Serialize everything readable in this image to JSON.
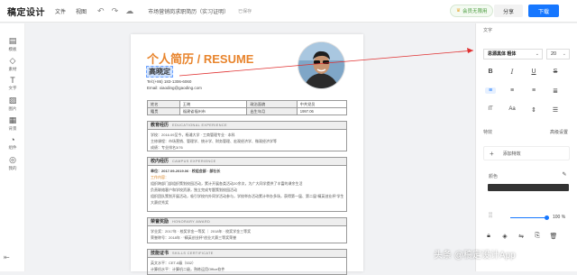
{
  "topbar": {
    "logo": "稿定设计",
    "file_menu": "文件",
    "view_menu": "视图",
    "doc_name": "市场营销岗求职简历（实习证明）",
    "save_state": "已保存",
    "vip": "会员无限用",
    "share": "分享",
    "download": "下载"
  },
  "left_tools": [
    {
      "icon": "layout-icon",
      "glyph": "▤",
      "label": "模板"
    },
    {
      "icon": "shapes-icon",
      "glyph": "◇",
      "label": "素材"
    },
    {
      "icon": "text-icon",
      "glyph": "T",
      "label": "文字"
    },
    {
      "icon": "image-icon",
      "glyph": "▨",
      "label": "图片"
    },
    {
      "icon": "background-icon",
      "glyph": "▦",
      "label": "背景"
    },
    {
      "icon": "chart-icon",
      "glyph": "◔",
      "label": "组件"
    },
    {
      "icon": "mine-icon",
      "glyph": "◎",
      "label": "我的"
    }
  ],
  "resume": {
    "title": "个人简历 / RESUME",
    "name": "高晓定",
    "tel": "Tel:(+86) 183-1306-6060",
    "email": "Email: xiaoding@gaoding.com",
    "info_rows": [
      [
        "姓名",
        "王晓",
        "政治面貌",
        "中共党员"
      ],
      [
        "籍贯",
        "福建省福州市",
        "出生年月",
        "1997.06"
      ]
    ],
    "sections": [
      {
        "title": "教育经历",
        "en": "EDUCATIONAL EXPERIENCE",
        "lines": [
          "学校：2016.09至今，杨浦大学 · 工商管理专业 · 本科",
          "主修课程：市场营销、管理学、统计学、财务管理、宏观经济学、微观经济学等",
          "成绩：专业排名3/76"
        ]
      },
      {
        "title": "校内经历",
        "en": "CAMPUS EXPERIENCE",
        "lines": [
          "单位：2017.09-2019.06 · 校组会部 · 部社长",
          "工作内容：",
          "组织跨部门部组织策划校园活动，累计开展各类活动20余次，为广大同学提供了丰富的课余生活",
          "负责联络客户和学校资源，独立完成专题策划校园活动",
          "组织团队策划开展活动，吸引学校内外同学活动参与，学校举办活动累计举办多场，获得第一届、第二届“精英创业杯”学生会组织",
          "大赛优秀奖"
        ]
      },
      {
        "title": "荣誉奖励",
        "en": "HONORARY AWARD",
        "lines": [
          "学业奖：2017年 · 校奖学金一等奖 ｜ 2018年 · 校奖学金三等奖",
          "荣誉称号：2018年 · “精英创业杯”创业大赛三等奖荣誉"
        ]
      },
      {
        "title": "技能证书",
        "en": "SKILLS CERTIFICATE",
        "lines": [
          "英文水平：CET-6级（532）",
          "计算机水平：计算机二级，熟练运用Office软件"
        ]
      }
    ]
  },
  "right_panel": {
    "section_title": "文字",
    "font": "思源黑体 粗体",
    "size": "20",
    "effects_label": "特效",
    "effects_advanced": "高级设置",
    "add_effect": "添加特效",
    "color_label": "颜色",
    "opacity": "100 %"
  },
  "watermark": "头条 @稿定设计App"
}
